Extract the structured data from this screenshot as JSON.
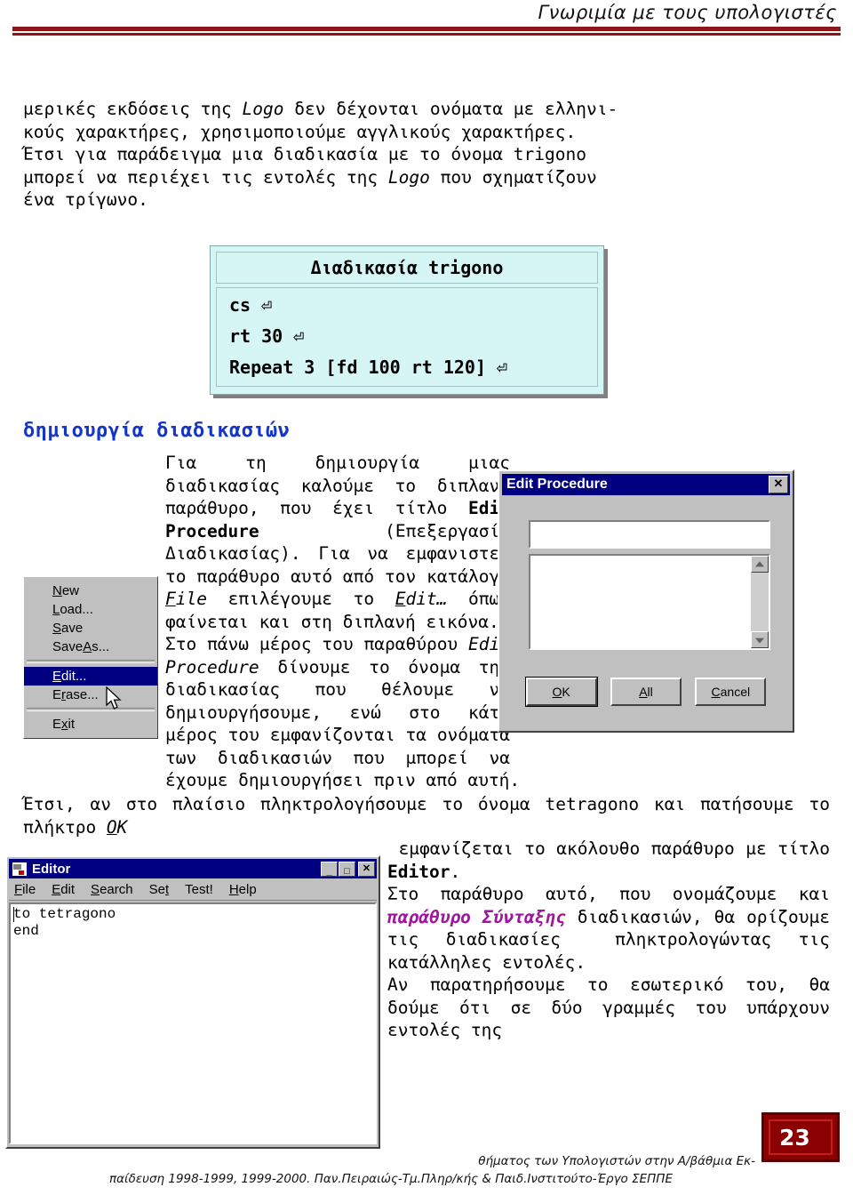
{
  "header": {
    "title": "Γνωριμία με τους υπολογιστές"
  },
  "intro": {
    "line1_a": "μερικές εκδόσεις της ",
    "line1_logo": "Logo",
    "line1_b": " δεν δέχονται ονόματα με ελληνι-\nκούς χαρακτήρες, χρησιμοποιούμε αγγλικούς χαρακτήρες.\nΈτσι για παράδειγμα μια διαδικασία με το όνομα trigono\nμπορεί να περιέχει τις εντολές της ",
    "line1_logo2": "Logo",
    "line1_c": " που σχηματίζουν\nένα τρίγωνο."
  },
  "code_box": {
    "title": "Διαδικασία trigono",
    "lines": [
      "cs ⏎",
      "rt 30 ⏎",
      "Repeat 3 [fd 100 rt 120] ⏎"
    ]
  },
  "section": {
    "heading": "δημιουργία διαδικασιών"
  },
  "body": {
    "p1_a": "Για τη δημιουργία μιας διαδικασίας καλούμε το διπλανό παράθυρο, που έχει τίτλο ",
    "p1_edit_procedure": "Edit Procedure",
    "p1_b": " (Επεξεργασία Διαδικασίας). Για να εμφανιστεί το παράθυρο αυτό από τον κατάλογο ",
    "p1_file_acc": "F",
    "p1_file_rest": "ile",
    "p1_c": " επιλέγουμε το ",
    "p1_edit_acc": "E",
    "p1_edit_rest": "dit…",
    "p1_d": " όπως φαίνεται και στη διπλανή εικόνα.",
    "p2_a": "Στο πάνω μέρος του παραθύρου ",
    "p2_edit_procedure": "Edit Procedure",
    "p2_b": " δίνουμε το όνομα της διαδικασίας που θέλουμε να δημιουργήσουμε, ενώ στο κάτω μέρος του εμφανίζονται τα ονόματα των διαδικασιών που μπορεί να έχουμε δημιουργήσει πριν από αυτή.",
    "p3_a": "Έτσι, αν στο πλαίσιο πληκτρολογήσουμε το όνομα tetragono και πατήσουμε το πλήκτρο ",
    "p3_ok_acc": "O",
    "p3_ok_rest": "K",
    "p3_b": " εμφανίζεται το ακόλουθο παράθυρο με τίτλο ",
    "p3_editor": "Editor",
    "p3_c": ".",
    "p4_a": "Στο παράθυρο αυτό, που ονομάζουμε και ",
    "p4_purple": "παράθυρο Σύνταξης",
    "p4_b": " διαδικασιών, θα ορίζουμε τις διαδικασίες  πληκτρολογώντας τις κατάλληλες εντολές.",
    "p5": "Αν παρατηρήσουμε το εσωτερικό του, θα δούμε ότι σε δύο γραμμές του υπάρχουν εντολές της"
  },
  "file_menu": {
    "items": [
      {
        "label_acc": "N",
        "label_rest": "ew",
        "selected": false,
        "separator_after": false
      },
      {
        "label_acc": "L",
        "label_rest": "oad...",
        "selected": false,
        "separator_after": false
      },
      {
        "label_acc": "S",
        "label_rest": "ave",
        "selected": false,
        "separator_after": false
      },
      {
        "label_pre": "Save",
        "label_acc": "A",
        "label_rest": "s...",
        "selected": false,
        "separator_after": true
      },
      {
        "label_acc": "E",
        "label_rest": "dit...",
        "selected": true,
        "separator_after": false
      },
      {
        "label_pre": "E",
        "label_acc": "r",
        "label_rest": "ase...",
        "selected": false,
        "separator_after": true
      },
      {
        "label_pre": "E",
        "label_acc": "x",
        "label_rest": "it",
        "selected": false,
        "separator_after": false
      }
    ]
  },
  "edit_procedure_dialog": {
    "title": "Edit Procedure",
    "close_label": "✕",
    "name_field_value": "",
    "list_items": [],
    "buttons": [
      {
        "acc": "O",
        "rest": "K",
        "default": true
      },
      {
        "acc": "A",
        "rest": "ll",
        "default": false
      },
      {
        "pre": "C",
        "acc": "",
        "rest": "ancel",
        "default": false
      }
    ],
    "button_ok": "OK",
    "button_all": "All",
    "button_cancel": "Cancel"
  },
  "editor_window": {
    "title": "Editor",
    "min_label": "_",
    "max_label": "□",
    "close_label": "✕",
    "menus": [
      {
        "acc": "F",
        "rest": "ile"
      },
      {
        "acc": "E",
        "rest": "dit"
      },
      {
        "acc": "S",
        "rest": "earch"
      },
      {
        "pre": "Se",
        "acc": "t",
        "rest": ""
      },
      {
        "pre": "Test!",
        "acc": "",
        "rest": ""
      },
      {
        "acc": "H",
        "rest": "elp"
      }
    ],
    "menu_labels": [
      "File",
      "Edit",
      "Search",
      "Set",
      "Test!",
      "Help"
    ],
    "content_lines": [
      "to tetragono",
      "end"
    ]
  },
  "footer": {
    "page_number": "23",
    "line1": "θήματος των Υπολογιστών στην  Α/βάθμια Εκ-",
    "line2": "παίδευση 1998-1999, 1999-2000. Παν.Πειραιώς-Τμ.Πληρ/κής & Παιδ.Ινστιτούτο-Έργο ΣΕΠΠΕ"
  },
  "colors": {
    "header_rule": "#8f1414",
    "heading_blue": "#1535c8",
    "purple_term": "#a0169e",
    "codebox_bg": "#d6f5f5",
    "win_titlebar": "#000080",
    "win_face": "#c0c0c0",
    "pagenum_bg": "#8b0000"
  }
}
